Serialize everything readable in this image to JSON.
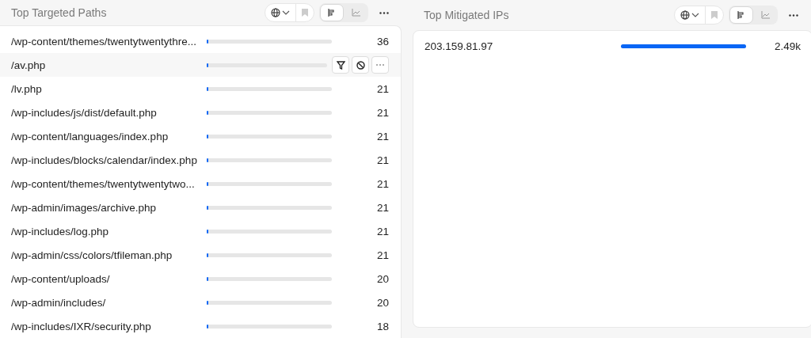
{
  "panels": [
    {
      "title": "Top Targeted Paths",
      "views": [
        {
          "kind": "bars",
          "selected": true
        },
        {
          "kind": "line",
          "selected": false
        }
      ],
      "rows": [
        {
          "label": "/wp-content/themes/twentytwentythre...",
          "level": 0.015,
          "value": "36",
          "hovered": false
        },
        {
          "label": "/av.php",
          "level": 0.01,
          "hovered": true
        },
        {
          "label": "/lv.php",
          "level": 0.01,
          "value": "21",
          "hovered": false
        },
        {
          "label": "/wp-includes/js/dist/default.php",
          "level": 0.01,
          "value": "21",
          "hovered": false
        },
        {
          "label": "/wp-content/languages/index.php",
          "level": 0.01,
          "value": "21",
          "hovered": false
        },
        {
          "label": "/wp-includes/blocks/calendar/index.php",
          "level": 0.01,
          "value": "21",
          "hovered": false
        },
        {
          "label": "/wp-content/themes/twentytwentytwo...",
          "level": 0.01,
          "value": "21",
          "hovered": false
        },
        {
          "label": "/wp-admin/images/archive.php",
          "level": 0.01,
          "value": "21",
          "hovered": false
        },
        {
          "label": "/wp-includes/log.php",
          "level": 0.01,
          "value": "21",
          "hovered": false
        },
        {
          "label": "/wp-admin/css/colors/tfileman.php",
          "level": 0.01,
          "value": "21",
          "hovered": false
        },
        {
          "label": "/wp-content/uploads/",
          "level": 0.01,
          "value": "20",
          "hovered": false
        },
        {
          "label": "/wp-admin/includes/",
          "level": 0.01,
          "value": "20",
          "hovered": false
        },
        {
          "label": "/wp-includes/IXR/security.php",
          "level": 0.01,
          "value": "18",
          "hovered": false
        }
      ]
    },
    {
      "title": "Top Mitigated IPs",
      "views": [
        {
          "kind": "bars",
          "selected": true
        },
        {
          "kind": "line",
          "selected": false
        }
      ],
      "rows": [
        {
          "label": "203.159.81.97",
          "level": 1,
          "value": "2.49k",
          "hovered": false
        }
      ]
    }
  ]
}
